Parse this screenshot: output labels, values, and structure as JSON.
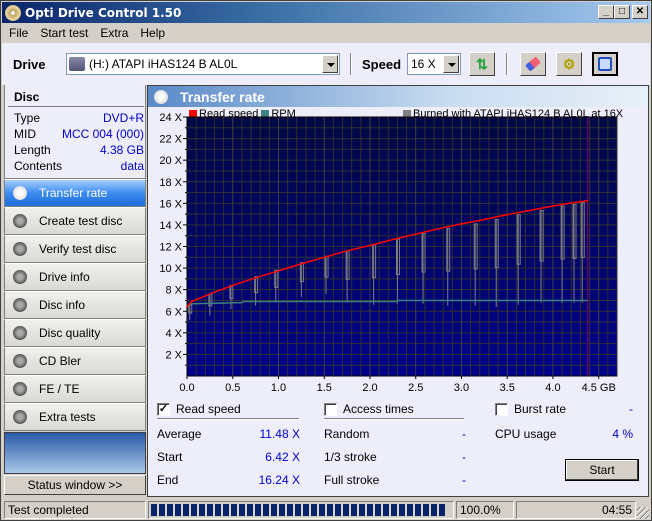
{
  "window": {
    "title": "Opti Drive Control 1.50",
    "controls": [
      "minimize",
      "maximize",
      "close"
    ]
  },
  "menu": [
    "File",
    "Start test",
    "Extra",
    "Help"
  ],
  "toolbar": {
    "drive_label": "Drive",
    "drive_value": "(H:)  ATAPI iHAS124   B AL0L",
    "speed_label": "Speed",
    "speed_value": "16 X",
    "buttons": [
      "refresh-icon",
      "eraser-icon",
      "settings-icon",
      "save-icon"
    ]
  },
  "disc": {
    "title": "Disc",
    "rows": [
      {
        "label": "Type",
        "value": "DVD+R"
      },
      {
        "label": "MID",
        "value": "MCC 004 (000)"
      },
      {
        "label": "Length",
        "value": "4.38 GB"
      },
      {
        "label": "Contents",
        "value": "data"
      }
    ]
  },
  "nav": [
    {
      "label": "Transfer rate",
      "active": true
    },
    {
      "label": "Create test disc"
    },
    {
      "label": "Verify test disc"
    },
    {
      "label": "Drive info"
    },
    {
      "label": "Disc info"
    },
    {
      "label": "Disc quality"
    },
    {
      "label": "CD Bler"
    },
    {
      "label": "FE / TE"
    },
    {
      "label": "Extra tests"
    }
  ],
  "status_window_label": "Status window >>",
  "panel": {
    "title": "Transfer rate",
    "legend": {
      "read_speed": "Read speed",
      "rpm": "RPM",
      "burned": "Burned with ATAPI iHAS124   B AL0L at 16X"
    },
    "colors": {
      "read_speed": "#ff0000",
      "rpm": "#408080",
      "burned": "#808080",
      "plot_bg_top": "#000840",
      "plot_bg_bottom": "#000090",
      "grid": "#303030",
      "end_marker": "#800080"
    }
  },
  "chart_data": {
    "type": "line",
    "title": "Transfer rate",
    "xlabel": "GB",
    "ylabel": "",
    "xlim": [
      0,
      4.7
    ],
    "ylim": [
      0,
      24
    ],
    "x_ticks": [
      "0.0",
      "0.5",
      "1.0",
      "1.5",
      "2.0",
      "2.5",
      "3.0",
      "3.5",
      "4.0",
      "4.5 GB"
    ],
    "x_tick_values": [
      0,
      0.5,
      1.0,
      1.5,
      2.0,
      2.5,
      3.0,
      3.5,
      4.0,
      4.5
    ],
    "y_ticks": [
      "2 X",
      "4 X",
      "6 X",
      "8 X",
      "10 X",
      "12 X",
      "14 X",
      "16 X",
      "18 X",
      "20 X",
      "22 X",
      "24 X"
    ],
    "y_tick_values": [
      2,
      4,
      6,
      8,
      10,
      12,
      14,
      16,
      18,
      20,
      22,
      24
    ],
    "grid": true,
    "legend_position": "top",
    "series": [
      {
        "name": "Read speed",
        "x": [
          0.0,
          0.05,
          0.25,
          0.5,
          0.75,
          1.0,
          1.25,
          1.5,
          1.75,
          2.0,
          2.25,
          2.5,
          2.75,
          3.0,
          3.25,
          3.5,
          3.75,
          4.0,
          4.25,
          4.38
        ],
        "values": [
          6.42,
          6.9,
          7.6,
          8.4,
          9.1,
          9.75,
          10.4,
          11.0,
          11.6,
          12.1,
          12.65,
          13.15,
          13.65,
          14.1,
          14.5,
          14.95,
          15.35,
          15.75,
          16.1,
          16.24
        ]
      },
      {
        "name": "RPM",
        "x": [
          0.0,
          0.05,
          0.6,
          0.61,
          2.3,
          2.31,
          4.38
        ],
        "values": [
          6.5,
          6.7,
          6.8,
          6.9,
          6.9,
          7.0,
          7.0
        ]
      }
    ],
    "burn_spikes": {
      "name": "Burned with ATAPI iHAS124 B AL0L at 16X",
      "x": [
        0.03,
        0.25,
        0.48,
        0.75,
        0.97,
        1.25,
        1.52,
        1.75,
        2.04,
        2.3,
        2.58,
        2.85,
        3.15,
        3.38,
        3.62,
        3.87,
        4.1,
        4.23,
        4.32
      ],
      "top": [
        6.6,
        7.6,
        8.4,
        9.2,
        9.8,
        10.5,
        11.1,
        11.6,
        12.2,
        12.7,
        13.2,
        13.65,
        14.1,
        14.5,
        14.95,
        15.35,
        15.75,
        15.9,
        16.1
      ],
      "bottom": [
        5.2,
        5.6,
        6.2,
        6.5,
        6.9,
        7.3,
        7.6,
        6.8,
        6.6,
        6.7,
        6.7,
        6.5,
        6.5,
        6.4,
        6.6,
        6.8,
        6.8,
        6.8,
        6.8
      ]
    }
  },
  "options": {
    "read_speed": {
      "label": "Read speed",
      "checked": true
    },
    "access_times": {
      "label": "Access times",
      "checked": false
    },
    "burst_rate": {
      "label": "Burst rate",
      "checked": false,
      "value": "-"
    }
  },
  "stats": {
    "average": {
      "label": "Average",
      "value": "11.48 X"
    },
    "start": {
      "label": "Start",
      "value": "6.42 X"
    },
    "end": {
      "label": "End",
      "value": "16.24 X"
    },
    "random": {
      "label": "Random",
      "value": "-"
    },
    "third_stroke": {
      "label": "1/3 stroke",
      "value": "-"
    },
    "full_stroke": {
      "label": "Full stroke",
      "value": "-"
    },
    "cpu_usage": {
      "label": "CPU usage",
      "value": "4 %"
    }
  },
  "start_button": "Start",
  "statusbar": {
    "message": "Test completed",
    "progress_percent": 100.0,
    "progress_text": "100.0%",
    "elapsed": "04:55"
  }
}
